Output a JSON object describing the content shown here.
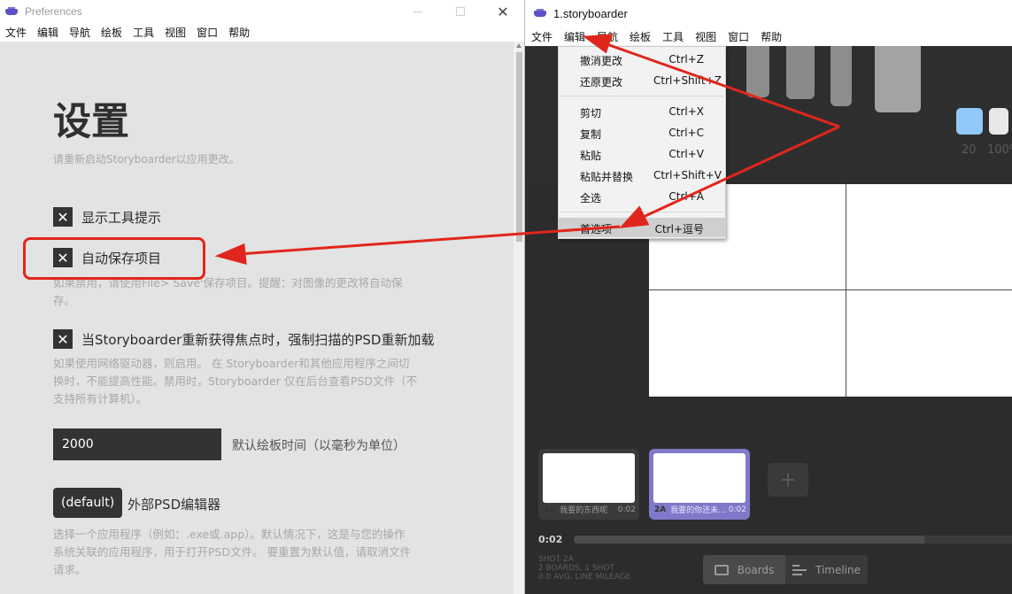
{
  "prefs_window": {
    "title": "Preferences",
    "menu": [
      "文件",
      "编辑",
      "导航",
      "绘板",
      "工具",
      "视图",
      "窗口",
      "帮助"
    ],
    "heading": "设置",
    "restart_note": "请重新启动Storyboarder以应用更改。",
    "show_tooltips": {
      "checked": true,
      "label": "显示工具提示"
    },
    "autosave": {
      "checked": true,
      "label": "自动保存项目",
      "desc_line1": "如果禁用，请使用File> Save'保存项目。提醒：对图像的更改将自动保",
      "desc_line2": "存。"
    },
    "psd_reload": {
      "checked": true,
      "label": "当Storyboarder重新获得焦点时，强制扫描的PSD重新加载",
      "desc_line1": "如果使用网络驱动器，则启用。 在 Storyboarder和其他应用程序之间切",
      "desc_line2": "换时，不能提高性能。禁用时，Storyboarder 仅在后台查看PSD文件（不",
      "desc_line3": "支持所有计算机）。"
    },
    "board_time": {
      "value": "2000",
      "label": "默认绘板时间（以毫秒为单位）"
    },
    "psd_editor": {
      "button": "(default)",
      "label": "外部PSD编辑器",
      "desc_line1": "选择一个应用程序（例如：.exe或.app）。默认情况下，这是与您的操作",
      "desc_line2": "系统关联的应用程序，用于打开PSD文件。 要重置为默认值，请取消文件",
      "desc_line3": "请求。"
    },
    "highlight_color": "#e0261c"
  },
  "main_window": {
    "title": "1.storyboarder",
    "menu": [
      "文件",
      "编辑",
      "导航",
      "绘板",
      "工具",
      "视图",
      "窗口",
      "帮助"
    ],
    "tool_values": [
      "20",
      "100%"
    ],
    "swatches": [
      "#90c8f8",
      "#e8e8e8"
    ],
    "edit_menu": [
      {
        "label": "撤消更改",
        "shortcut": "Ctrl+Z"
      },
      {
        "label": "还原更改",
        "shortcut": "Ctrl+Shift+Z"
      },
      {
        "label": "剪切",
        "shortcut": "Ctrl+X"
      },
      {
        "label": "复制",
        "shortcut": "Ctrl+C"
      },
      {
        "label": "粘贴",
        "shortcut": "Ctrl+V"
      },
      {
        "label": "粘贴并替换",
        "shortcut": "Ctrl+Shift+V"
      },
      {
        "label": "全选",
        "shortcut": "Ctrl+A"
      },
      {
        "label": "首选项",
        "shortcut": "Ctrl+逗号",
        "highlighted": true
      }
    ],
    "boards": [
      {
        "id": "1A",
        "caption": "我要的东西呢",
        "time": "0:02",
        "selected": false
      },
      {
        "id": "2A",
        "caption": "我要的你还未...",
        "time": "0:02",
        "selected": true
      }
    ],
    "add_board": "+",
    "current_time": "0:02",
    "meta": {
      "line1": "SHOT 2A",
      "line2": "2 BOARDS, 1 SHOT",
      "line3": "0.0 AVG. LINE MILEAGE"
    },
    "view_toggle": {
      "boards": "Boards",
      "timeline": "Timeline",
      "active": "boards"
    }
  },
  "annotation_color": "#e0261c"
}
